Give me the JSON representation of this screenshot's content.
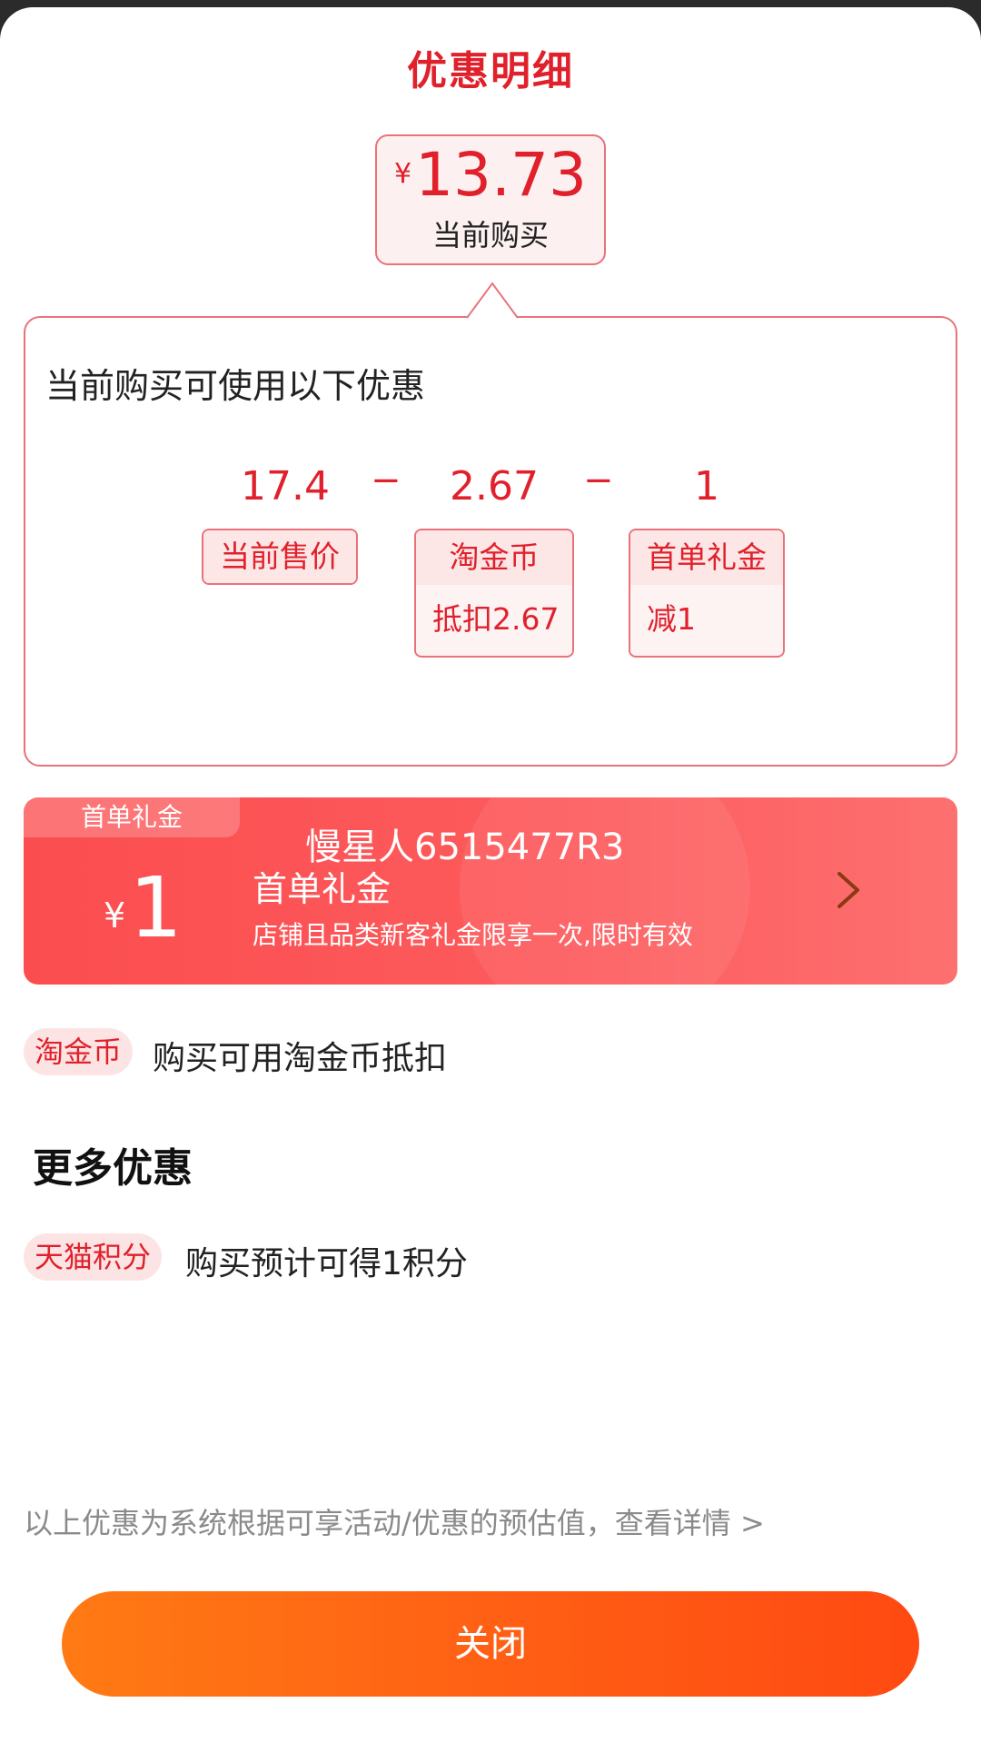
{
  "header": {
    "title": "优惠明细"
  },
  "current_price": {
    "currency": "¥",
    "amount": "13.73",
    "label": "当前购买"
  },
  "detail": {
    "heading": "当前购买可使用以下优惠",
    "calc": [
      {
        "value": "17.4",
        "tag_title": "当前售价",
        "tag_detail": ""
      },
      {
        "value": "2.67",
        "tag_title": "淘金币",
        "tag_detail": "抵扣2.67"
      },
      {
        "value": "1",
        "tag_title": "首单礼金",
        "tag_detail": "减1"
      }
    ],
    "operator": "−"
  },
  "coupon": {
    "tab_label": "首单礼金",
    "currency": "¥",
    "amount": "1",
    "shop_name": "慢星人6515477R3",
    "name": "首单礼金",
    "description": "店铺且品类新客礼金限享一次,限时有效",
    "arrow_icon": "chevron-right-icon"
  },
  "taojinbi_row": {
    "pill": "淘金币",
    "text": "购买可用淘金币抵扣"
  },
  "more": {
    "title": "更多优惠",
    "tmall_row": {
      "pill": "天猫积分",
      "text": "购买预计可得1积分"
    }
  },
  "footnote": "以上优惠为系统根据可享活动/优惠的预估值，查看详情 >",
  "close_button": "关闭",
  "colors": {
    "accent_red": "#e0212c",
    "coupon_red": "#fb4d4f",
    "button_orange": "#ff6a14"
  }
}
